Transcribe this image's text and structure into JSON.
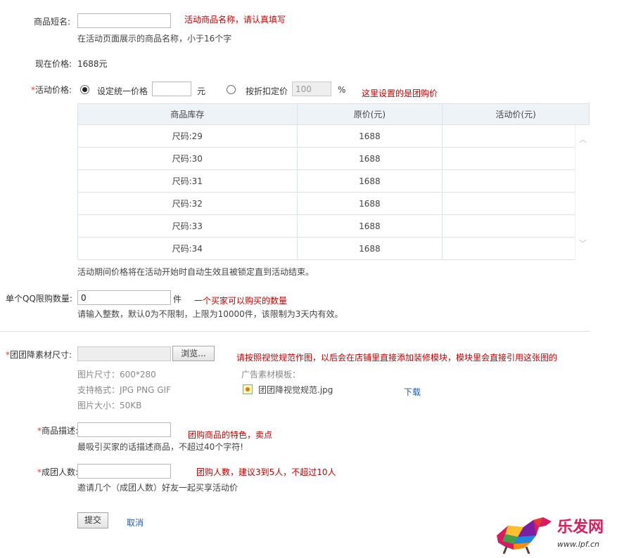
{
  "short_name": {
    "label": "商品短名:",
    "annotation": "活动商品名称，请认真填写",
    "hint": "在活动页面展示的商品名称，小于16个字"
  },
  "current_price": {
    "label": "现在价格:",
    "value": "1688元"
  },
  "activity_price": {
    "required_mark": "*",
    "label": "活动价格:",
    "option_uniform": "设定统一价格",
    "unit_yuan": "元",
    "option_discount": "按折扣定价",
    "discount_value": "100",
    "unit_percent": "%",
    "annotation": "这里设置的是团购价",
    "table": {
      "headers": [
        "商品库存",
        "原价(元)",
        "活动价(元)"
      ],
      "rows": [
        {
          "sku": "尺码:29",
          "price": "1688",
          "activity": ""
        },
        {
          "sku": "尺码:30",
          "price": "1688",
          "activity": ""
        },
        {
          "sku": "尺码:31",
          "price": "1688",
          "activity": ""
        },
        {
          "sku": "尺码:32",
          "price": "1688",
          "activity": ""
        },
        {
          "sku": "尺码:33",
          "price": "1688",
          "activity": ""
        },
        {
          "sku": "尺码:34",
          "price": "1688",
          "activity": ""
        }
      ]
    },
    "hint": "活动期间价格将在活动开始时自动生效且被锁定直到活动结束。"
  },
  "qq_limit": {
    "label": "单个QQ限购数量:",
    "value": "0",
    "unit": "件",
    "annotation": "一个买家可以购买的数量",
    "hint": "请输入整数，默认0为不限制，上限为10000件，该限制为3天内有效。"
  },
  "material": {
    "required_mark": "*",
    "label": "团团降素材尺寸:",
    "browse_label": "浏览...",
    "annotation": "请按照视觉规范作图，以后会在店铺里直接添加装修模块，模块里会直接引用这张图的",
    "size": "图片尺寸：600*280",
    "formats": "支持格式：JPG PNG GIF",
    "filesize": "图片大小：50KB",
    "template_label": "广告素材模板：",
    "template_file": "团团降视觉规范.jpg",
    "download_label": "下载"
  },
  "description": {
    "required_mark": "*",
    "label": "商品描述:",
    "annotation": "团购商品的特色，卖点",
    "hint": "最吸引买家的话描述商品，不超过40个字符!"
  },
  "group_size": {
    "required_mark": "*",
    "label": "成团人数:",
    "annotation": "团购人数，建议3到5人，不超过10人",
    "hint": "邀请几个（成团人数）好友一起买享活动价"
  },
  "actions": {
    "submit_label": "提交",
    "cancel_label": "取消"
  },
  "watermark": {
    "brand": "乐发网",
    "url": "www.lpf.cn"
  }
}
